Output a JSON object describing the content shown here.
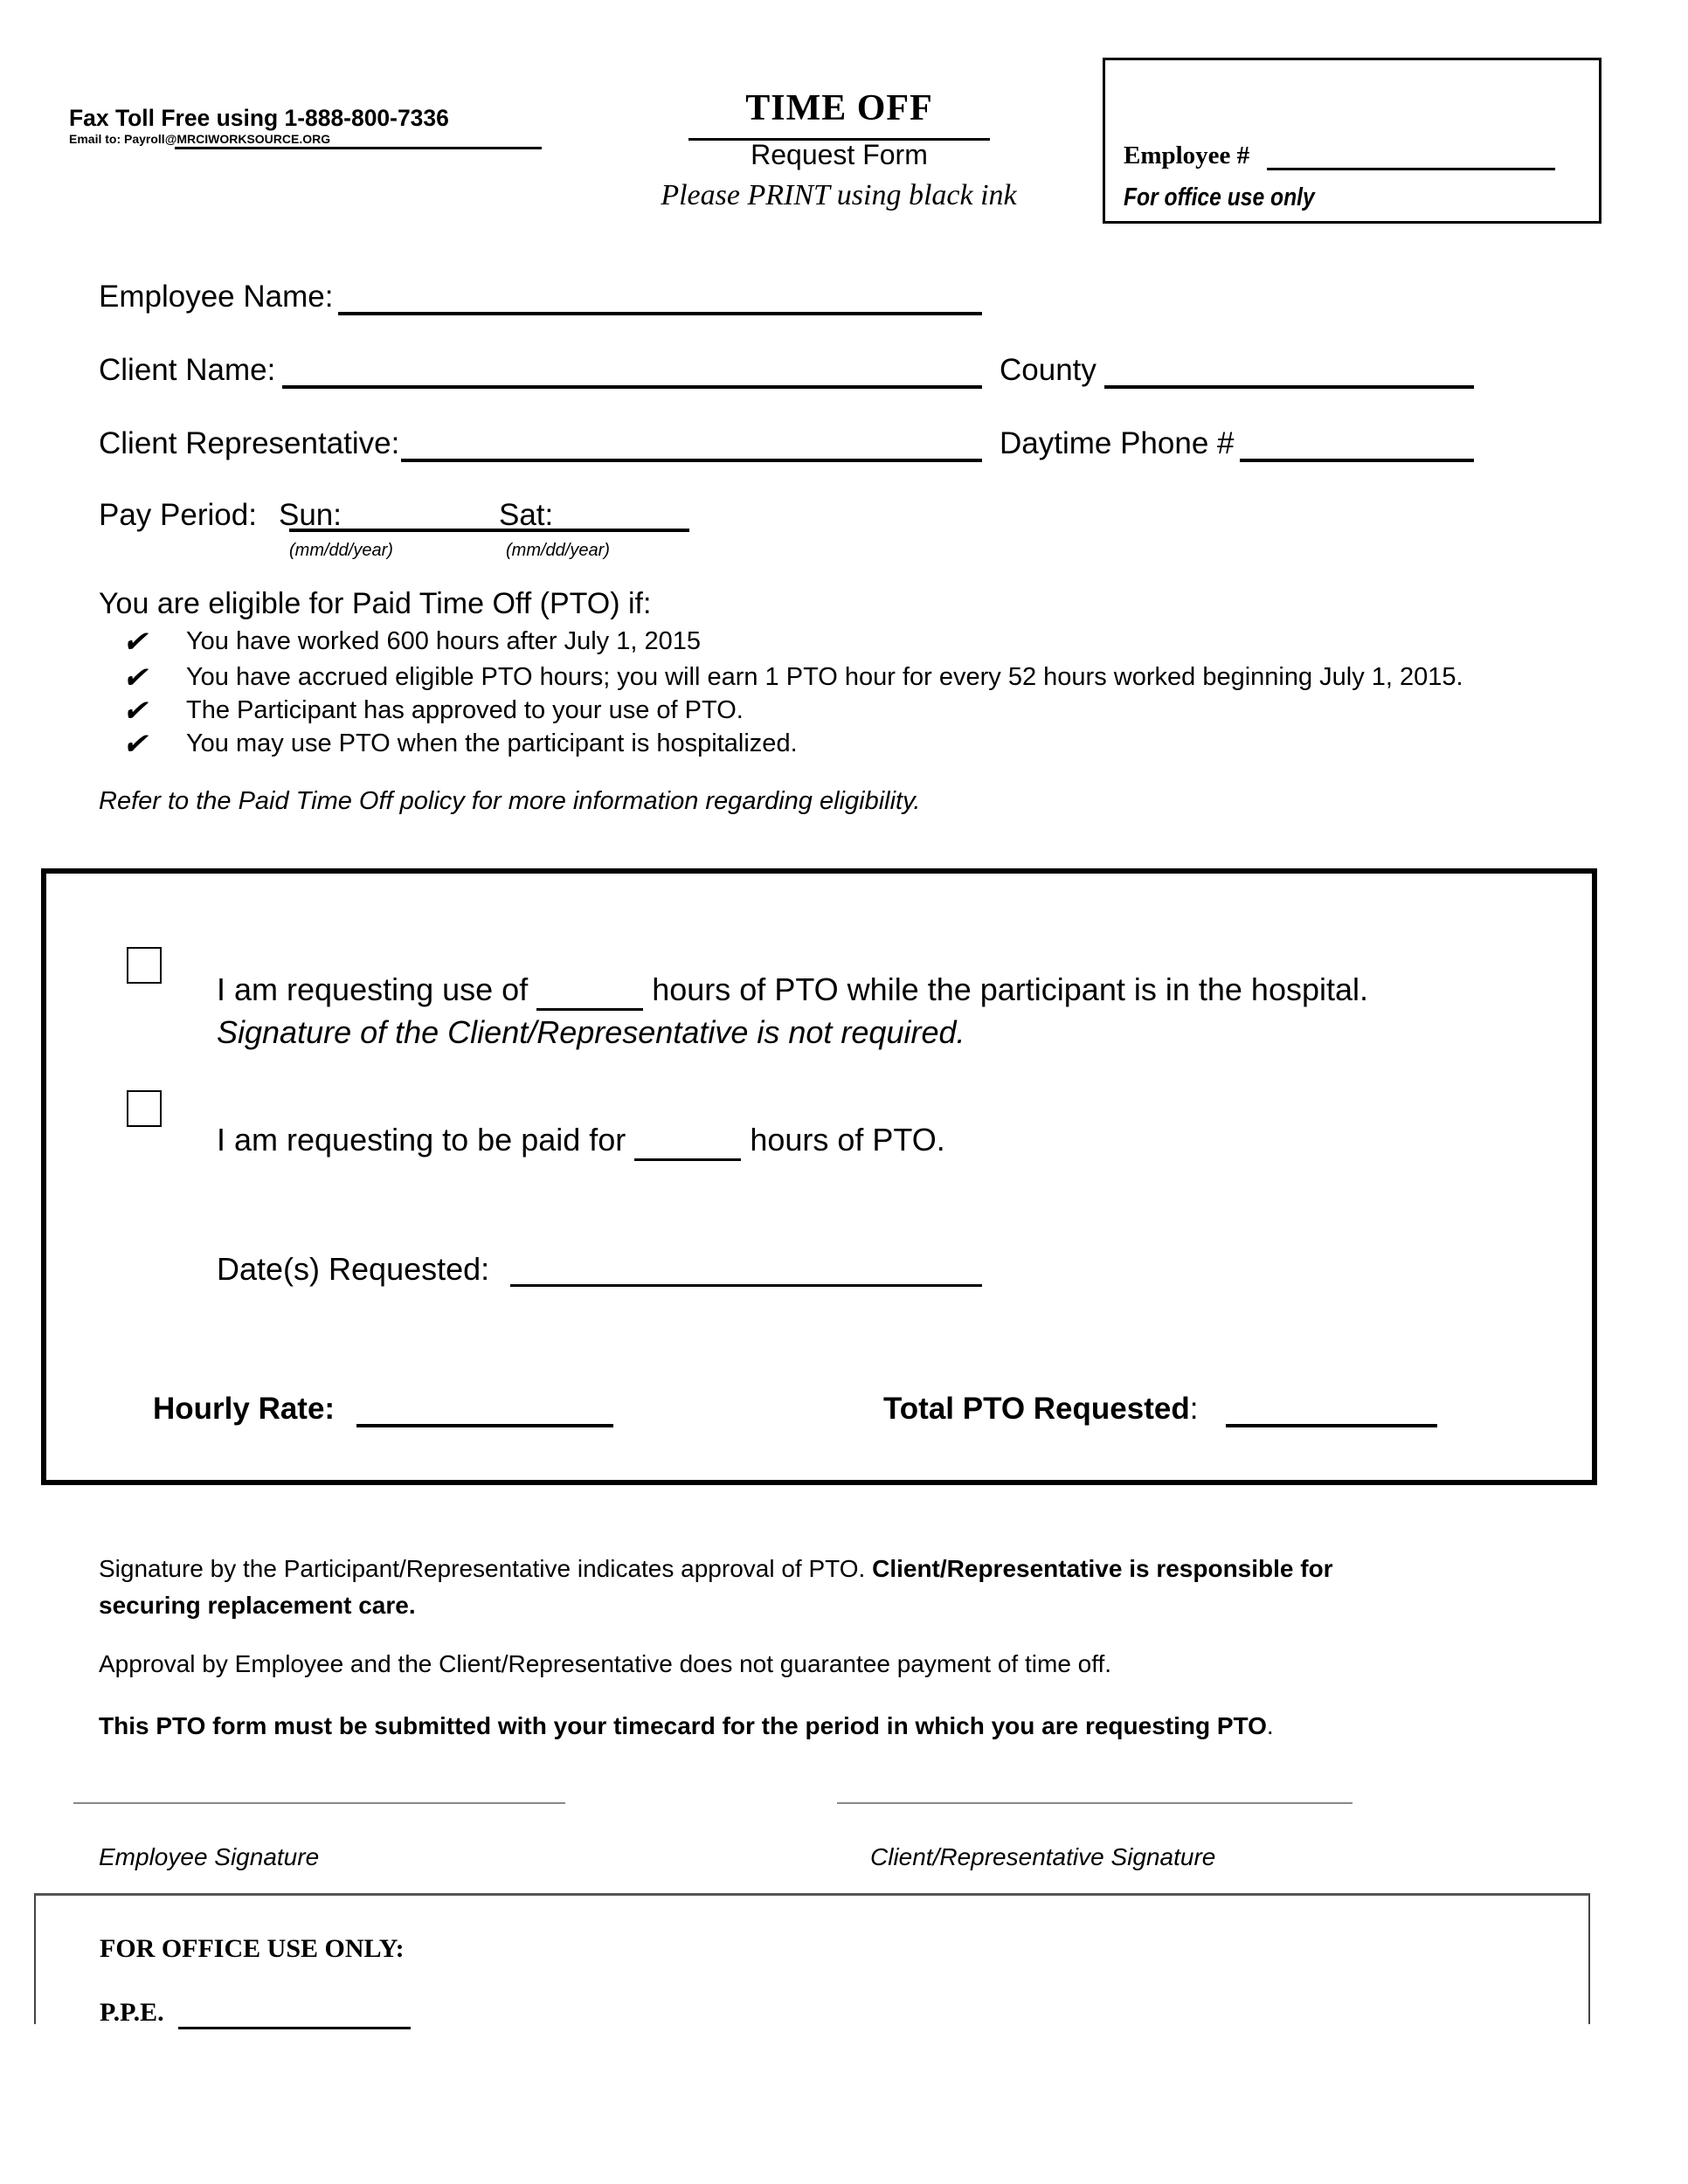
{
  "header": {
    "fax": "Fax Toll Free using 1-888-800-7336",
    "email_prefix": "Email to: Payroll",
    "email_domain": "@MRCIWORKSOURCE.ORG",
    "title": "TIME OFF",
    "subtitle": "Request Form",
    "print_note": "Please PRINT using black ink"
  },
  "office_box": {
    "employee_number_label": "Employee #",
    "office_use_label": "For office use only"
  },
  "fields": {
    "employee_name": "Employee Name:",
    "client_name": "Client Name:",
    "county": "County",
    "client_representative": "Client Representative:",
    "daytime_phone": "Daytime Phone #",
    "pay_period": "Pay Period:",
    "sun": "Sun:",
    "sat": "Sat:",
    "date_hint": "(mm/dd/year)"
  },
  "eligibility": {
    "heading": "You are eligible for Paid Time Off (PTO) if:",
    "check_glyph": "✔",
    "items": [
      "You have worked 600 hours after July 1, 2015",
      "You have accrued eligible PTO hours; you will earn 1 PTO hour for every 52 hours worked beginning July 1, 2015.",
      "The Participant has approved to your use of PTO.",
      "You may use PTO when the participant is hospitalized."
    ],
    "note": "Refer to the Paid Time Off policy for more information regarding eligibility."
  },
  "request": {
    "option1_pre": "I am requesting use of",
    "option1_post": "hours of PTO while the participant is in the hospital.",
    "option1_note": "Signature of the Client/Representative is not required.",
    "option2_pre": "I am requesting to be paid for",
    "option2_post": "hours of PTO.",
    "dates_requested": "Date(s) Requested:",
    "hourly_rate": "Hourly Rate:",
    "total_pto": "Total PTO Requested",
    "total_pto_colon": ":"
  },
  "notes": {
    "approval_normal": "Signature by the Participant/Representative indicates approval of PTO. ",
    "approval_bold_1": "Client/Representative is responsible for",
    "approval_bold_2": "securing replacement care.",
    "guarantee": "Approval by Employee and the Client/Representative does not guarantee payment of time off.",
    "submit_bold": "This PTO form must be submitted with your timecard for the period in which you are requesting PTO",
    "submit_end": "."
  },
  "signatures": {
    "employee": "Employee Signature",
    "client": "Client/Representative Signature"
  },
  "office_use": {
    "title": "FOR OFFICE USE ONLY:",
    "ppe": "P.P.E."
  }
}
